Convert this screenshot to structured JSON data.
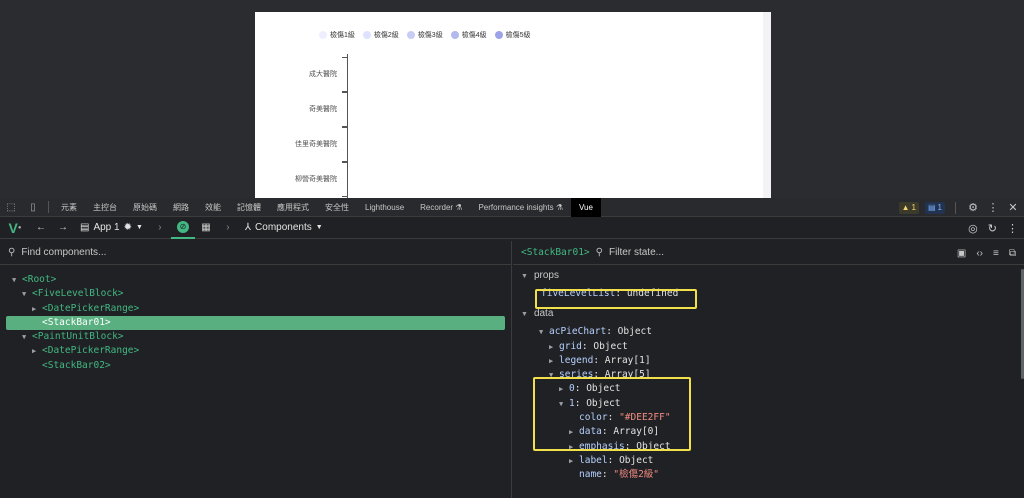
{
  "chart": {
    "legend": [
      {
        "label": "檢傷1級",
        "color": "#EEEEFF"
      },
      {
        "label": "檢傷2級",
        "color": "#DEE2FF"
      },
      {
        "label": "檢傷3級",
        "color": "#C8CCF5"
      },
      {
        "label": "檢傷4級",
        "color": "#B3B8EE"
      },
      {
        "label": "檢傷5級",
        "color": "#9DA3E8"
      }
    ],
    "categories": [
      "成大醫院",
      "奇美醫院",
      "佳里奇美醫院",
      "柳營奇美醫院"
    ]
  },
  "tabbar": {
    "tabs": [
      "元素",
      "主控台",
      "原始碼",
      "網路",
      "效能",
      "記憶體",
      "應用程式",
      "安全性",
      "Lighthouse",
      "Recorder ⚗",
      "Performance insights ⚗",
      "Vue"
    ],
    "active": "Vue",
    "warn_count": "1",
    "info_count": "1"
  },
  "vuebar": {
    "app_label": "App 1",
    "components_label": "Components"
  },
  "left": {
    "search_placeholder": "Find components...",
    "tree": [
      {
        "depth": 0,
        "arrow": "▼",
        "label": "<Root>"
      },
      {
        "depth": 1,
        "arrow": "▼",
        "label": "<FiveLevelBlock>"
      },
      {
        "depth": 2,
        "arrow": "▶",
        "label": "<DatePickerRange>"
      },
      {
        "depth": 2,
        "arrow": "",
        "label": "<StackBar01>",
        "selected": true
      },
      {
        "depth": 1,
        "arrow": "▼",
        "label": "<PaintUnitBlock>"
      },
      {
        "depth": 2,
        "arrow": "▶",
        "label": "<DatePickerRange>"
      },
      {
        "depth": 2,
        "arrow": "",
        "label": "<StackBar02>"
      }
    ]
  },
  "right": {
    "component": "<StackBar01>",
    "filter_placeholder": "Filter state...",
    "props_title": "props",
    "data_title": "data",
    "props": {
      "key": "fiveLevelList",
      "value": "undefined"
    },
    "lines": [
      {
        "depth": 1,
        "arrow": "▼",
        "key": "acPieChart",
        "value": "Object"
      },
      {
        "depth": 2,
        "arrow": "▶",
        "key": "grid",
        "value": "Object"
      },
      {
        "depth": 2,
        "arrow": "▶",
        "key": "legend",
        "value": "Array[1]"
      },
      {
        "depth": 2,
        "arrow": "▼",
        "key": "series",
        "value": "Array[5]"
      },
      {
        "depth": 3,
        "arrow": "▶",
        "key": "0",
        "value": "Object"
      },
      {
        "depth": 3,
        "arrow": "▼",
        "key": "1",
        "value": "Object"
      },
      {
        "depth": 4,
        "arrow": "",
        "key": "color",
        "value": "\"#DEE2FF\"",
        "str": true
      },
      {
        "depth": 4,
        "arrow": "▶",
        "key": "data",
        "value": "Array[0]"
      },
      {
        "depth": 4,
        "arrow": "▶",
        "key": "emphasis",
        "value": "Object"
      },
      {
        "depth": 4,
        "arrow": "▶",
        "key": "label",
        "value": "Object"
      },
      {
        "depth": 4,
        "arrow": "",
        "key": "name",
        "value": "\"檢傷2級\"",
        "str": true
      }
    ]
  }
}
